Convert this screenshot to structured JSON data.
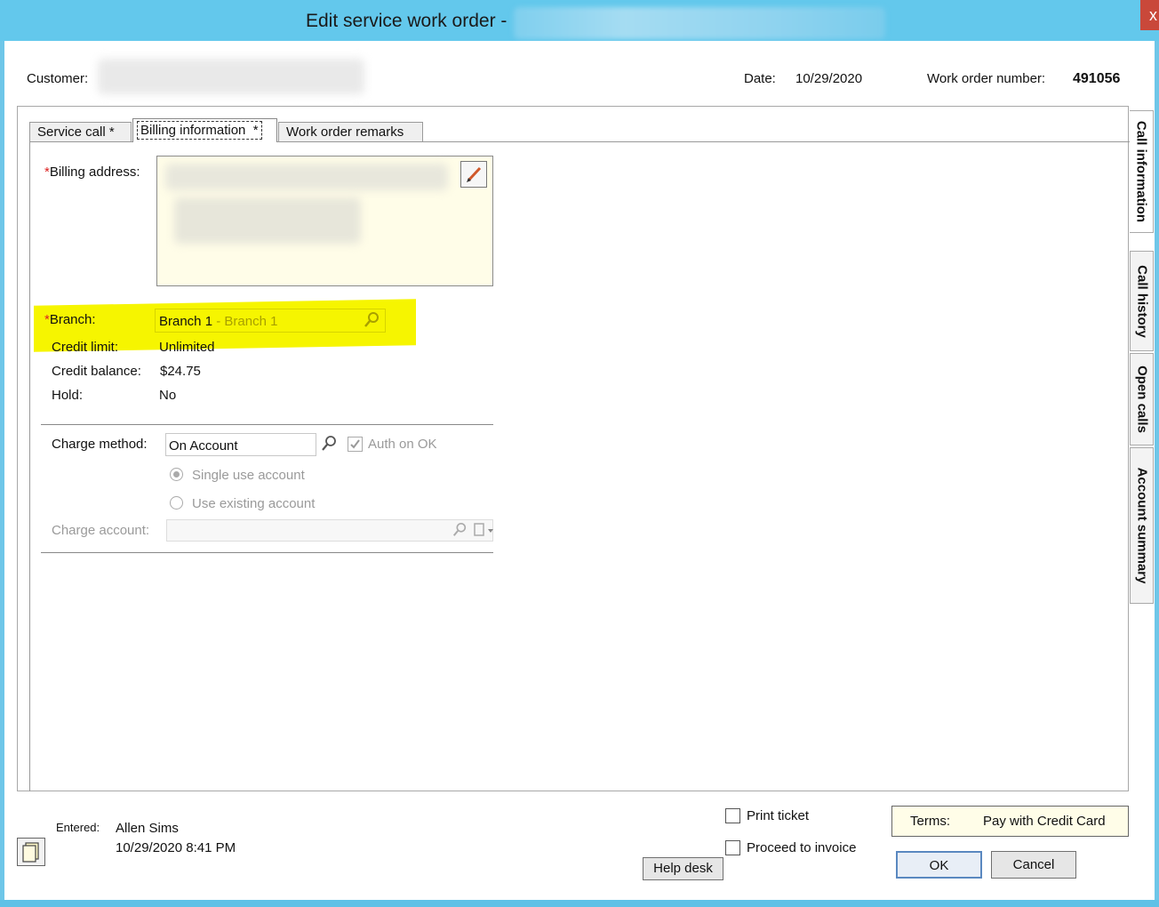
{
  "window": {
    "title": "Edit service work order -",
    "close_glyph": "x"
  },
  "header": {
    "customer_label": "Customer:",
    "date_label": "Date:",
    "date_value": "10/29/2020",
    "wo_label": "Work order number:",
    "wo_value": "491056"
  },
  "tabs": [
    {
      "label": "Service call",
      "modified": "*"
    },
    {
      "label": "Billing information",
      "modified": "*"
    },
    {
      "label": "Work order remarks"
    }
  ],
  "side_tabs": [
    "Call information",
    "Call history",
    "Open calls",
    "Account summary"
  ],
  "billing": {
    "required_mark": "*",
    "address_label": "Billing address:",
    "branch_label": "Branch:",
    "branch_value": "Branch 1",
    "branch_desc": "- Branch 1",
    "credit_limit_label": "Credit limit:",
    "credit_limit_value": "Unlimited",
    "credit_balance_label": "Credit balance:",
    "credit_balance_value": "$24.75",
    "hold_label": "Hold:",
    "hold_value": "No"
  },
  "charge": {
    "method_label": "Charge method:",
    "method_value": "On Account",
    "auth_label": "Auth on OK",
    "auth_checked": true,
    "single_use_label": "Single use account",
    "existing_label": "Use existing account",
    "selected_option": "single_use",
    "account_label": "Charge account:",
    "account_value": ""
  },
  "footer": {
    "entered_label": "Entered:",
    "entered_by": "Allen Sims",
    "entered_at": "10/29/2020 8:41 PM",
    "print_ticket_label": "Print ticket",
    "proceed_label": "Proceed to invoice",
    "help_desk_label": "Help desk",
    "terms_label": "Terms:",
    "terms_value": "Pay with Credit Card",
    "ok_label": "OK",
    "cancel_label": "Cancel"
  },
  "colors": {
    "title_bar": "#63c8ec",
    "highlight": "#f6f500",
    "required": "#dd2222",
    "billing_box": "#fffde8"
  },
  "icons": [
    "close-icon",
    "pencil-icon",
    "magnifier-icon",
    "checkbox-icon",
    "radio-icon",
    "notes-icon",
    "dropdown-icon"
  ]
}
